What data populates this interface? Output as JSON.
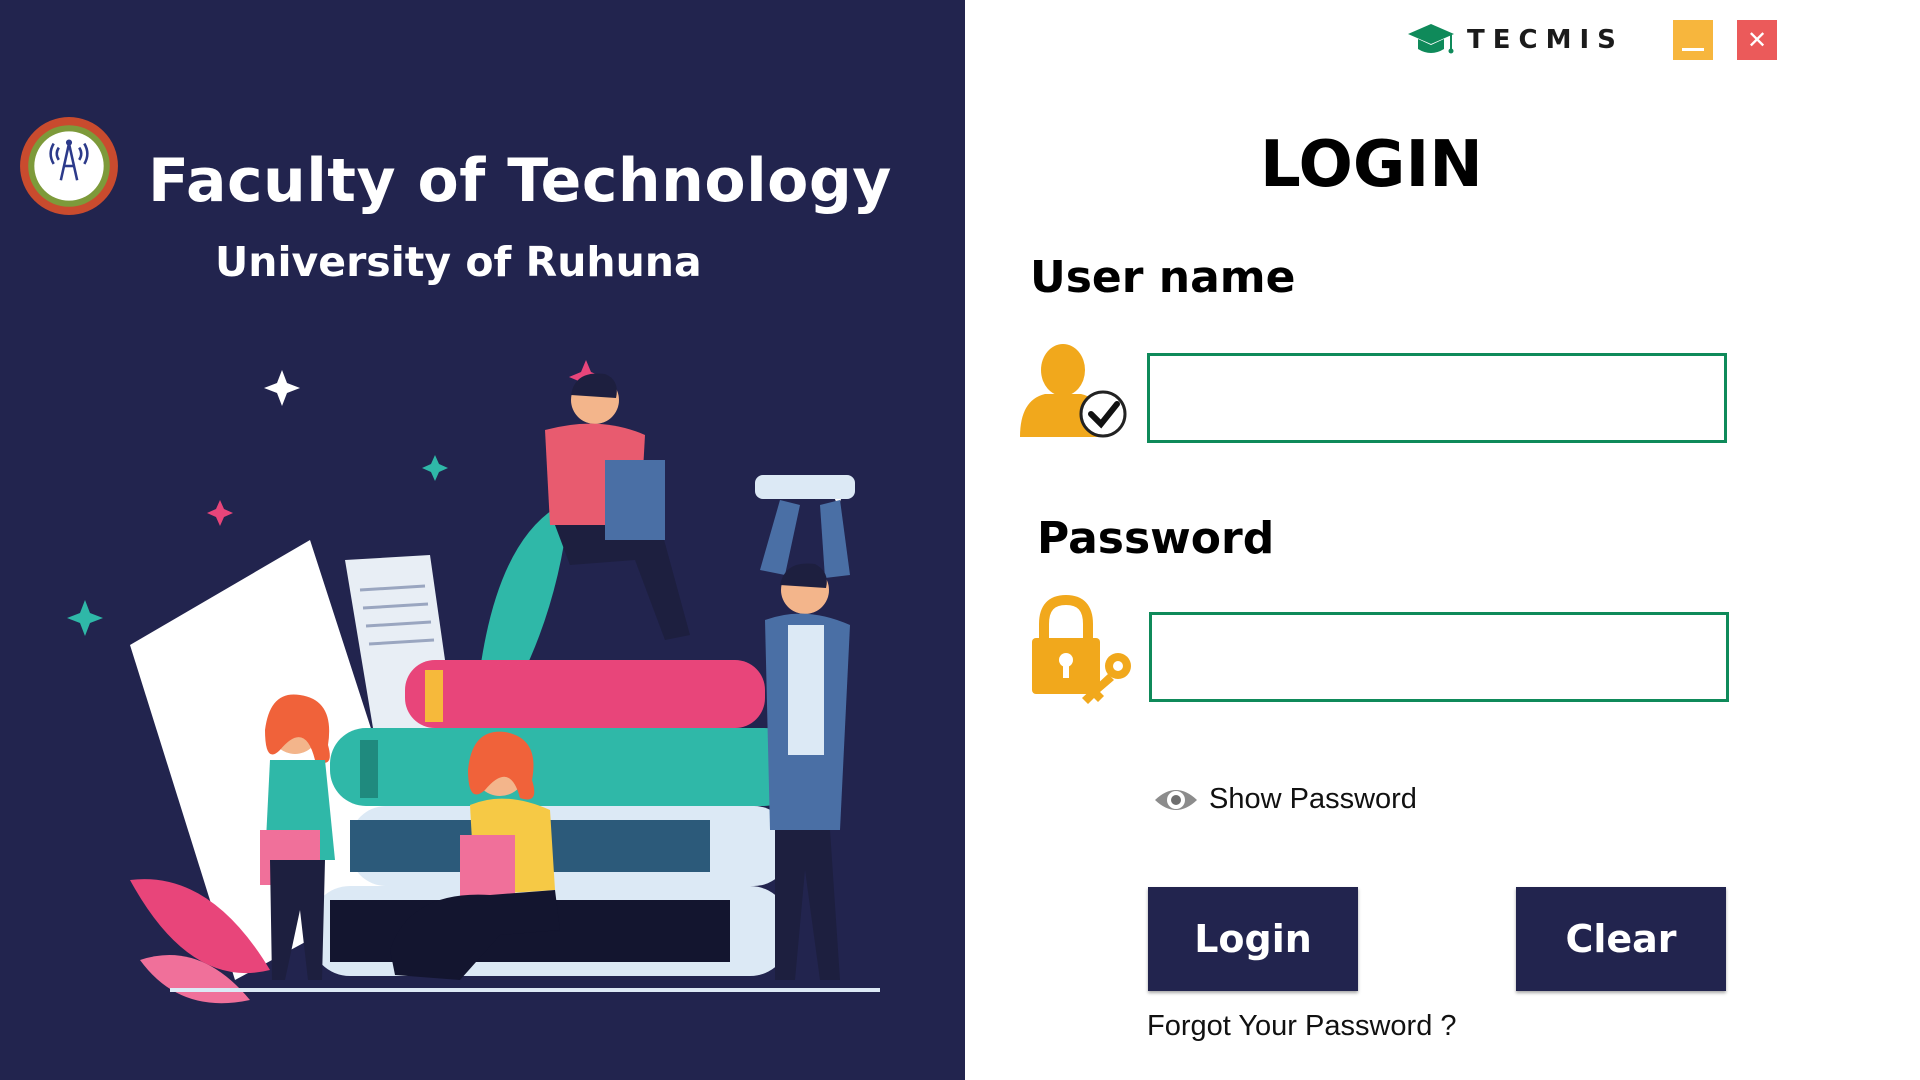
{
  "left_panel": {
    "title": "Faculty of Technology",
    "subtitle": "University of Ruhuna",
    "logo_icon": "faculty-seal-icon",
    "background_color": "#22244e"
  },
  "brand": {
    "name": "TECMIS",
    "icon": "graduation-cap-icon",
    "color": "#0f8a5a"
  },
  "window_controls": {
    "minimize_color": "#f7b63d",
    "close_color": "#eb5a5a",
    "close_glyph": "✕"
  },
  "form": {
    "heading": "LOGIN",
    "username": {
      "label": "User name",
      "value": "",
      "placeholder": "",
      "icon": "user-check-icon"
    },
    "password": {
      "label": "Password",
      "value": "",
      "placeholder": "",
      "icon": "lock-key-icon"
    },
    "show_password": {
      "label": "Show Password",
      "icon": "eye-icon"
    },
    "login_button": "Login",
    "clear_button": "Clear",
    "forgot_password": "Forgot Your Password ?",
    "accent_color": "#0f8a5a",
    "button_color": "#22244e",
    "icon_color": "#f1a81c"
  }
}
